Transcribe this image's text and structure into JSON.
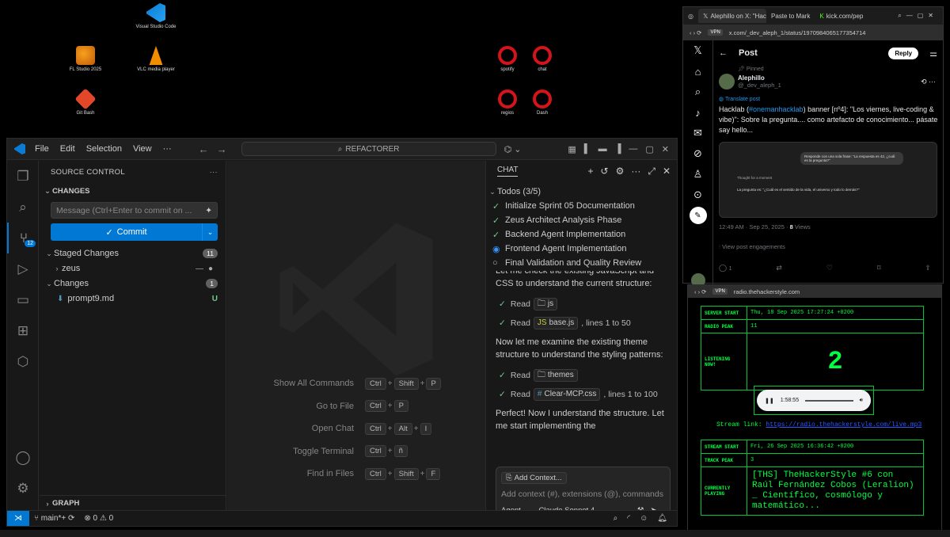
{
  "desktop": {
    "icons": [
      {
        "label": "Visual Studio Code",
        "icon": "vscode-icon"
      },
      {
        "label": "FL Studio 2025",
        "icon": "fl-studio-icon"
      },
      {
        "label": "VLC media player",
        "icon": "vlc-icon"
      },
      {
        "label": "Git Bash",
        "icon": "git-icon"
      },
      {
        "label": "spotify",
        "icon": "opera-icon"
      },
      {
        "label": "chat",
        "icon": "opera-icon"
      },
      {
        "label": "regios",
        "icon": "opera-icon"
      },
      {
        "label": "Dash",
        "icon": "opera-icon"
      }
    ]
  },
  "vscode": {
    "menu": [
      "File",
      "Edit",
      "Selection",
      "View"
    ],
    "more": "···",
    "search": "REFACTORER",
    "activity_badge": "12",
    "sidebar": {
      "title": "SOURCE CONTROL",
      "changes_section": "CHANGES",
      "message_placeholder": "Message (Ctrl+Enter to commit on ...",
      "commit_label": "Commit",
      "staged_label": "Staged Changes",
      "staged_count": "11",
      "staged_item": "zeus",
      "changes_label": "Changes",
      "changes_count": "1",
      "changed_file": "prompt9.md",
      "changed_status": "U",
      "graph_label": "GRAPH"
    },
    "shortcuts": [
      {
        "label": "Show All Commands",
        "keys": [
          "Ctrl",
          "Shift",
          "P"
        ]
      },
      {
        "label": "Go to File",
        "keys": [
          "Ctrl",
          "P"
        ]
      },
      {
        "label": "Open Chat",
        "keys": [
          "Ctrl",
          "Alt",
          "I"
        ]
      },
      {
        "label": "Toggle Terminal",
        "keys": [
          "Ctrl",
          "ñ"
        ]
      },
      {
        "label": "Find in Files",
        "keys": [
          "Ctrl",
          "Shift",
          "F"
        ]
      }
    ],
    "chat": {
      "tab": "CHAT",
      "todos_header": "Todos (3/5)",
      "todos": [
        {
          "label": "Initialize Sprint 05 Documentation",
          "state": "done"
        },
        {
          "label": "Zeus Architect Analysis Phase",
          "state": "done"
        },
        {
          "label": "Backend Agent Implementation",
          "state": "done"
        },
        {
          "label": "Frontend Agent Implementation",
          "state": "in-progress"
        },
        {
          "label": "Final Validation and Quality Review",
          "state": "pending"
        }
      ],
      "msg1": "Let me check the existing JavaScript and CSS to understand the current structure:",
      "read1_label": "Read",
      "read1_chip": "js",
      "read2_label": "Read",
      "read2_chip": "base.js",
      "read2_suffix": ", lines 1 to 50",
      "msg2": "Now let me examine the existing theme structure to understand the styling patterns:",
      "read3_label": "Read",
      "read3_chip": "themes",
      "read4_label": "Read",
      "read4_chip": "Clear-MCP.css",
      "read4_suffix": ", lines 1 to 100",
      "msg3": "Perfect! Now I understand the structure. Let me start implementing the",
      "add_context": "Add Context...",
      "input_placeholder": "Add context (#), extensions (@), commands",
      "mode": "Agent",
      "model": "Claude Sonnet 4"
    },
    "status": {
      "branch": "main*+",
      "errors": "0",
      "warnings": "0"
    }
  },
  "browser_x": {
    "tabs": [
      "Alephillo on X: \"Hackla",
      "Paste to Mark",
      "kick.com/pep"
    ],
    "url": "x.com/_dev_aleph_1/status/1970984065177354714",
    "vpn": "VPN",
    "header": "Post",
    "reply": "Reply",
    "pinned": "Pinned",
    "author_name": "Alephillo",
    "author_handle": "@_dev_aleph_1",
    "translate": "Translate post",
    "post_pre": "Hacklab (",
    "post_tag": "#onemanhacklab",
    "post_post": ") banner [nº4]: \"Los viernes, live-coding & vibe)\": Sobre la pregunta.... como artefacto de conocimiento... pásate say hello...",
    "img_bubble": "Responde con una sola frase: \"La respuesta es 42, ¿cuál es la pregunta?\"",
    "img_thought": "Thought for a moment",
    "img_answer": "La pregunta es: \"¿Cuál es el sentido de la vida, el universo y todo lo demás?\"",
    "time": "12:49 AM · Sep 25, 2025 · ",
    "views_count": "8",
    "views_label": " Views",
    "engagements": "View post engagements",
    "reply_count": "1"
  },
  "browser_radio": {
    "url": "radio.thehackerstyle.com",
    "vpn": "VPN",
    "rows1": [
      {
        "k": "SERVER START",
        "v": "Thu, 18 Sep 2025 17:27:24 +0200"
      },
      {
        "k": "RADIO PEAK",
        "v": "11"
      },
      {
        "k": "LISTENING NOW!",
        "v": "2"
      }
    ],
    "player_time": "1:58:55",
    "stream_label": "Stream link:",
    "stream_url": "https://radio.thehackerstyle.com/live.mp3",
    "rows2": [
      {
        "k": "STREAM START",
        "v": "Fri, 26 Sep 2025 16:36:42 +0200"
      },
      {
        "k": "TRACK PEAK",
        "v": "3"
      },
      {
        "k": "CURRENTLY PLAYING",
        "v": "[THS] TheHackerStyle #6 con Raúl Fernández Cobos (Leralion) _ Científico, cosmólogo y matemático..."
      }
    ]
  }
}
